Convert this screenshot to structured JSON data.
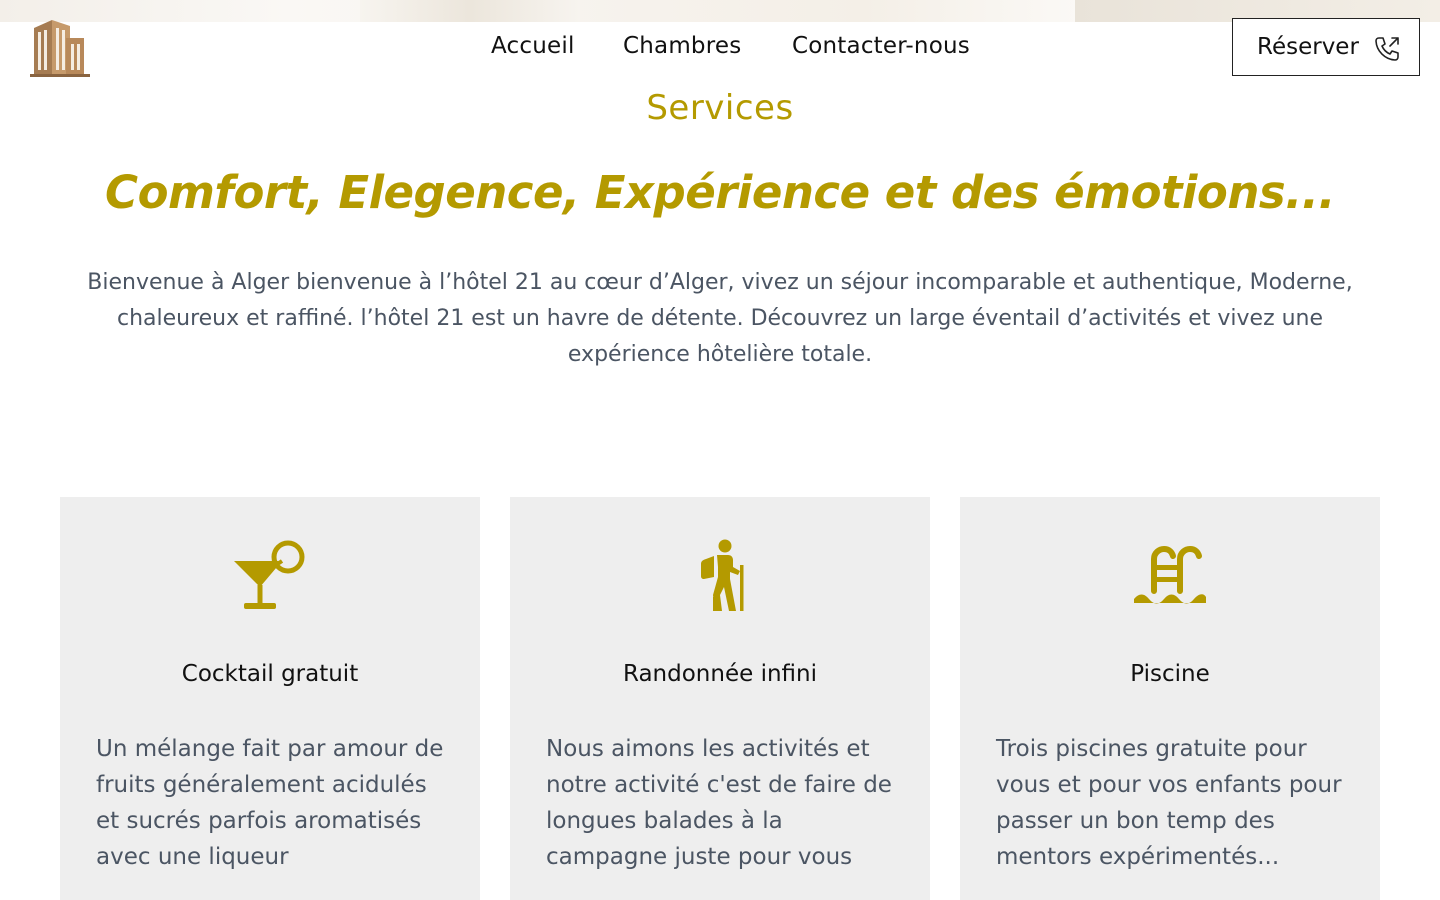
{
  "header": {
    "logo_icon": "hotel-building-icon",
    "nav": [
      {
        "label": "Accueil"
      },
      {
        "label": "Chambres"
      },
      {
        "label": "Contacter-nous"
      }
    ],
    "reserve_label": "Réserver",
    "reserve_icon": "phone-outgoing-icon"
  },
  "main": {
    "section_label": "Services",
    "headline": "Comfort, Elegence, Expérience et des émotions...",
    "intro": "Bienvenue à Alger bienvenue à l’hôtel 21 au cœur d’Alger, vivez un séjour incomparable et authentique, Moderne, chaleureux et raffiné. l’hôtel 21 est un havre de détente. Découvrez un large éventail d’activités et vivez une expérience hôtelière totale."
  },
  "services": [
    {
      "icon": "cocktail-icon",
      "title": "Cocktail gratuit",
      "description": "Un mélange fait par amour de fruits généralement acidulés et sucrés parfois aromatisés avec une liqueur"
    },
    {
      "icon": "hiking-icon",
      "title": "Randonnée infini",
      "description": "Nous aimons les activités et notre activité c'est de faire de longues balades à la campagne juste pour vous"
    },
    {
      "icon": "swimming-pool-icon",
      "title": "Piscine",
      "description": "Trois piscines gratuite pour vous et pour vos enfants pour passer un bon temp des mentors expérimentés..."
    }
  ],
  "colors": {
    "accent": "#b49a00",
    "text_muted": "#4b5563",
    "card_bg": "#eeeeee",
    "logo_brown": "#a67c52"
  }
}
